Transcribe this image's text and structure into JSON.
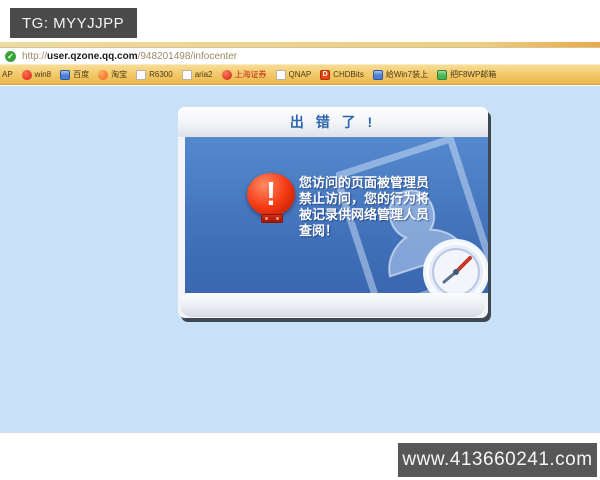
{
  "top_banner": {
    "text": "TG: MYYJJPP"
  },
  "browser": {
    "security_icon": "green-check-icon",
    "url_prefix": "http://",
    "url_host": "user.qzone.qq.com",
    "url_path": "/948201498/infocenter",
    "bookmarks": [
      {
        "label": "AP",
        "icon": "none"
      },
      {
        "label": "win8",
        "icon": "red-badge"
      },
      {
        "label": "百度",
        "icon": "blue-square"
      },
      {
        "label": "淘宝",
        "icon": "orange-circle"
      },
      {
        "label": "R6300",
        "icon": "doc"
      },
      {
        "label": "aria2",
        "icon": "doc"
      },
      {
        "label": "上海证券",
        "icon": "red-circle",
        "label_color": "#c02318"
      },
      {
        "label": "QNAP",
        "icon": "doc"
      },
      {
        "label": "CHDBits",
        "icon": "red-square",
        "icon_text": "D"
      },
      {
        "label": "给Win7装上",
        "icon": "blue-square"
      },
      {
        "label": "把F8WP邮箱",
        "icon": "green-square"
      }
    ]
  },
  "error_dialog": {
    "title": "出 错 了 !",
    "alert_icon": "red-exclamation-lantern",
    "message_lines": [
      "您访问的页面被管理员",
      "禁止访问，您的行为将",
      "被记录供网络管理人员",
      "查阅！"
    ]
  },
  "site_banner": {
    "text": "www.413660241.com"
  },
  "colors": {
    "page_background": "#c9e1f6",
    "tg_banner_background": "#4a4a4a",
    "site_banner_background": "#575757",
    "toolbar_orange": "#f2c765",
    "dialog_body_blue_top": "#5589cd",
    "dialog_body_blue_bottom": "#3a67b0",
    "dialog_title_blue": "#2f66ae",
    "alert_red": "#f33912",
    "url_host_color": "#1c1c1c"
  }
}
